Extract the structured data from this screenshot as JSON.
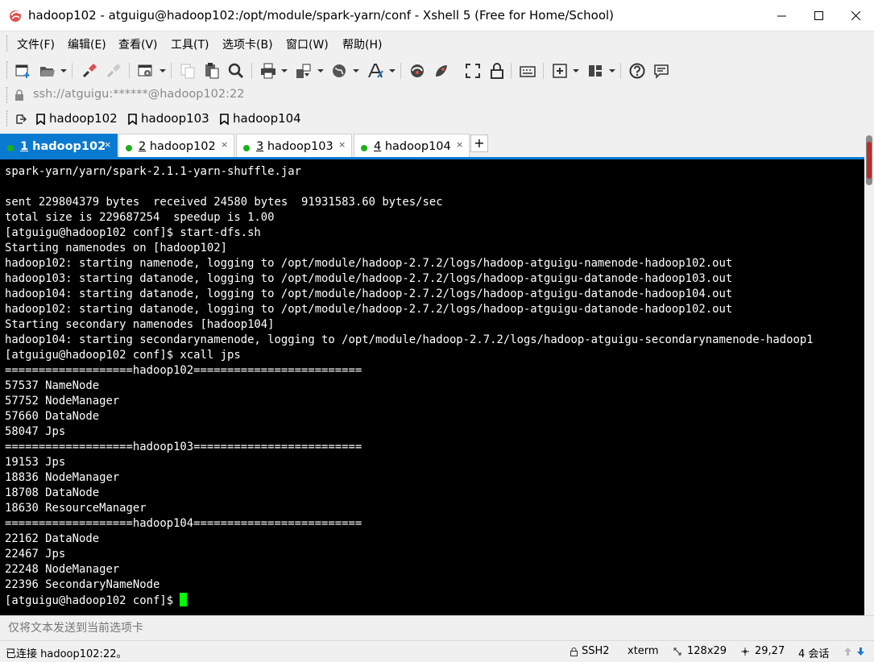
{
  "window": {
    "title": "hadoop102 - atguigu@hadoop102:/opt/module/spark-yarn/conf - Xshell 5 (Free for Home/School)"
  },
  "menu": [
    "文件(F)",
    "编辑(E)",
    "查看(V)",
    "工具(T)",
    "选项卡(B)",
    "窗口(W)",
    "帮助(H)"
  ],
  "address": "ssh://atguigu:******@hadoop102:22",
  "links": [
    "hadoop102",
    "hadoop103",
    "hadoop104"
  ],
  "tabs": [
    {
      "num": "1",
      "name": " hadoop102",
      "close": "×"
    },
    {
      "num": "2",
      "name": " hadoop102",
      "close": "×"
    },
    {
      "num": "3",
      "name": " hadoop103",
      "close": "×"
    },
    {
      "num": "4",
      "name": " hadoop104",
      "close": "×"
    }
  ],
  "tab_add": "+",
  "terminal": {
    "lines": [
      "spark-yarn/yarn/spark-2.1.1-yarn-shuffle.jar",
      "",
      "sent 229804379 bytes  received 24580 bytes  91931583.60 bytes/sec",
      "total size is 229687254  speedup is 1.00",
      "[atguigu@hadoop102 conf]$ start-dfs.sh",
      "Starting namenodes on [hadoop102]",
      "hadoop102: starting namenode, logging to /opt/module/hadoop-2.7.2/logs/hadoop-atguigu-namenode-hadoop102.out",
      "hadoop103: starting datanode, logging to /opt/module/hadoop-2.7.2/logs/hadoop-atguigu-datanode-hadoop103.out",
      "hadoop104: starting datanode, logging to /opt/module/hadoop-2.7.2/logs/hadoop-atguigu-datanode-hadoop104.out",
      "hadoop102: starting datanode, logging to /opt/module/hadoop-2.7.2/logs/hadoop-atguigu-datanode-hadoop102.out",
      "Starting secondary namenodes [hadoop104]",
      "hadoop104: starting secondarynamenode, logging to /opt/module/hadoop-2.7.2/logs/hadoop-atguigu-secondarynamenode-hadoop1",
      "[atguigu@hadoop102 conf]$ xcall jps",
      "===================hadoop102=========================",
      "57537 NameNode",
      "57752 NodeManager",
      "57660 DataNode",
      "58047 Jps",
      "===================hadoop103=========================",
      "19153 Jps",
      "18836 NodeManager",
      "18708 DataNode",
      "18630 ResourceManager",
      "===================hadoop104=========================",
      "22162 DataNode",
      "22467 Jps",
      "22248 NodeManager",
      "22396 SecondaryNameNode"
    ],
    "prompt": "[atguigu@hadoop102 conf]$ "
  },
  "compose": {
    "placeholder": "仅将文本发送到当前选项卡"
  },
  "status": {
    "connection": "已连接 hadoop102:22。",
    "protocol": "SSH2",
    "term": "xterm",
    "size": "128x29",
    "cursor_pos": "29,27",
    "sessions": "4 会话"
  },
  "colors": {
    "accent": "#0a7ad1",
    "cursor": "#00ff00",
    "connected": "#1ab01a"
  }
}
